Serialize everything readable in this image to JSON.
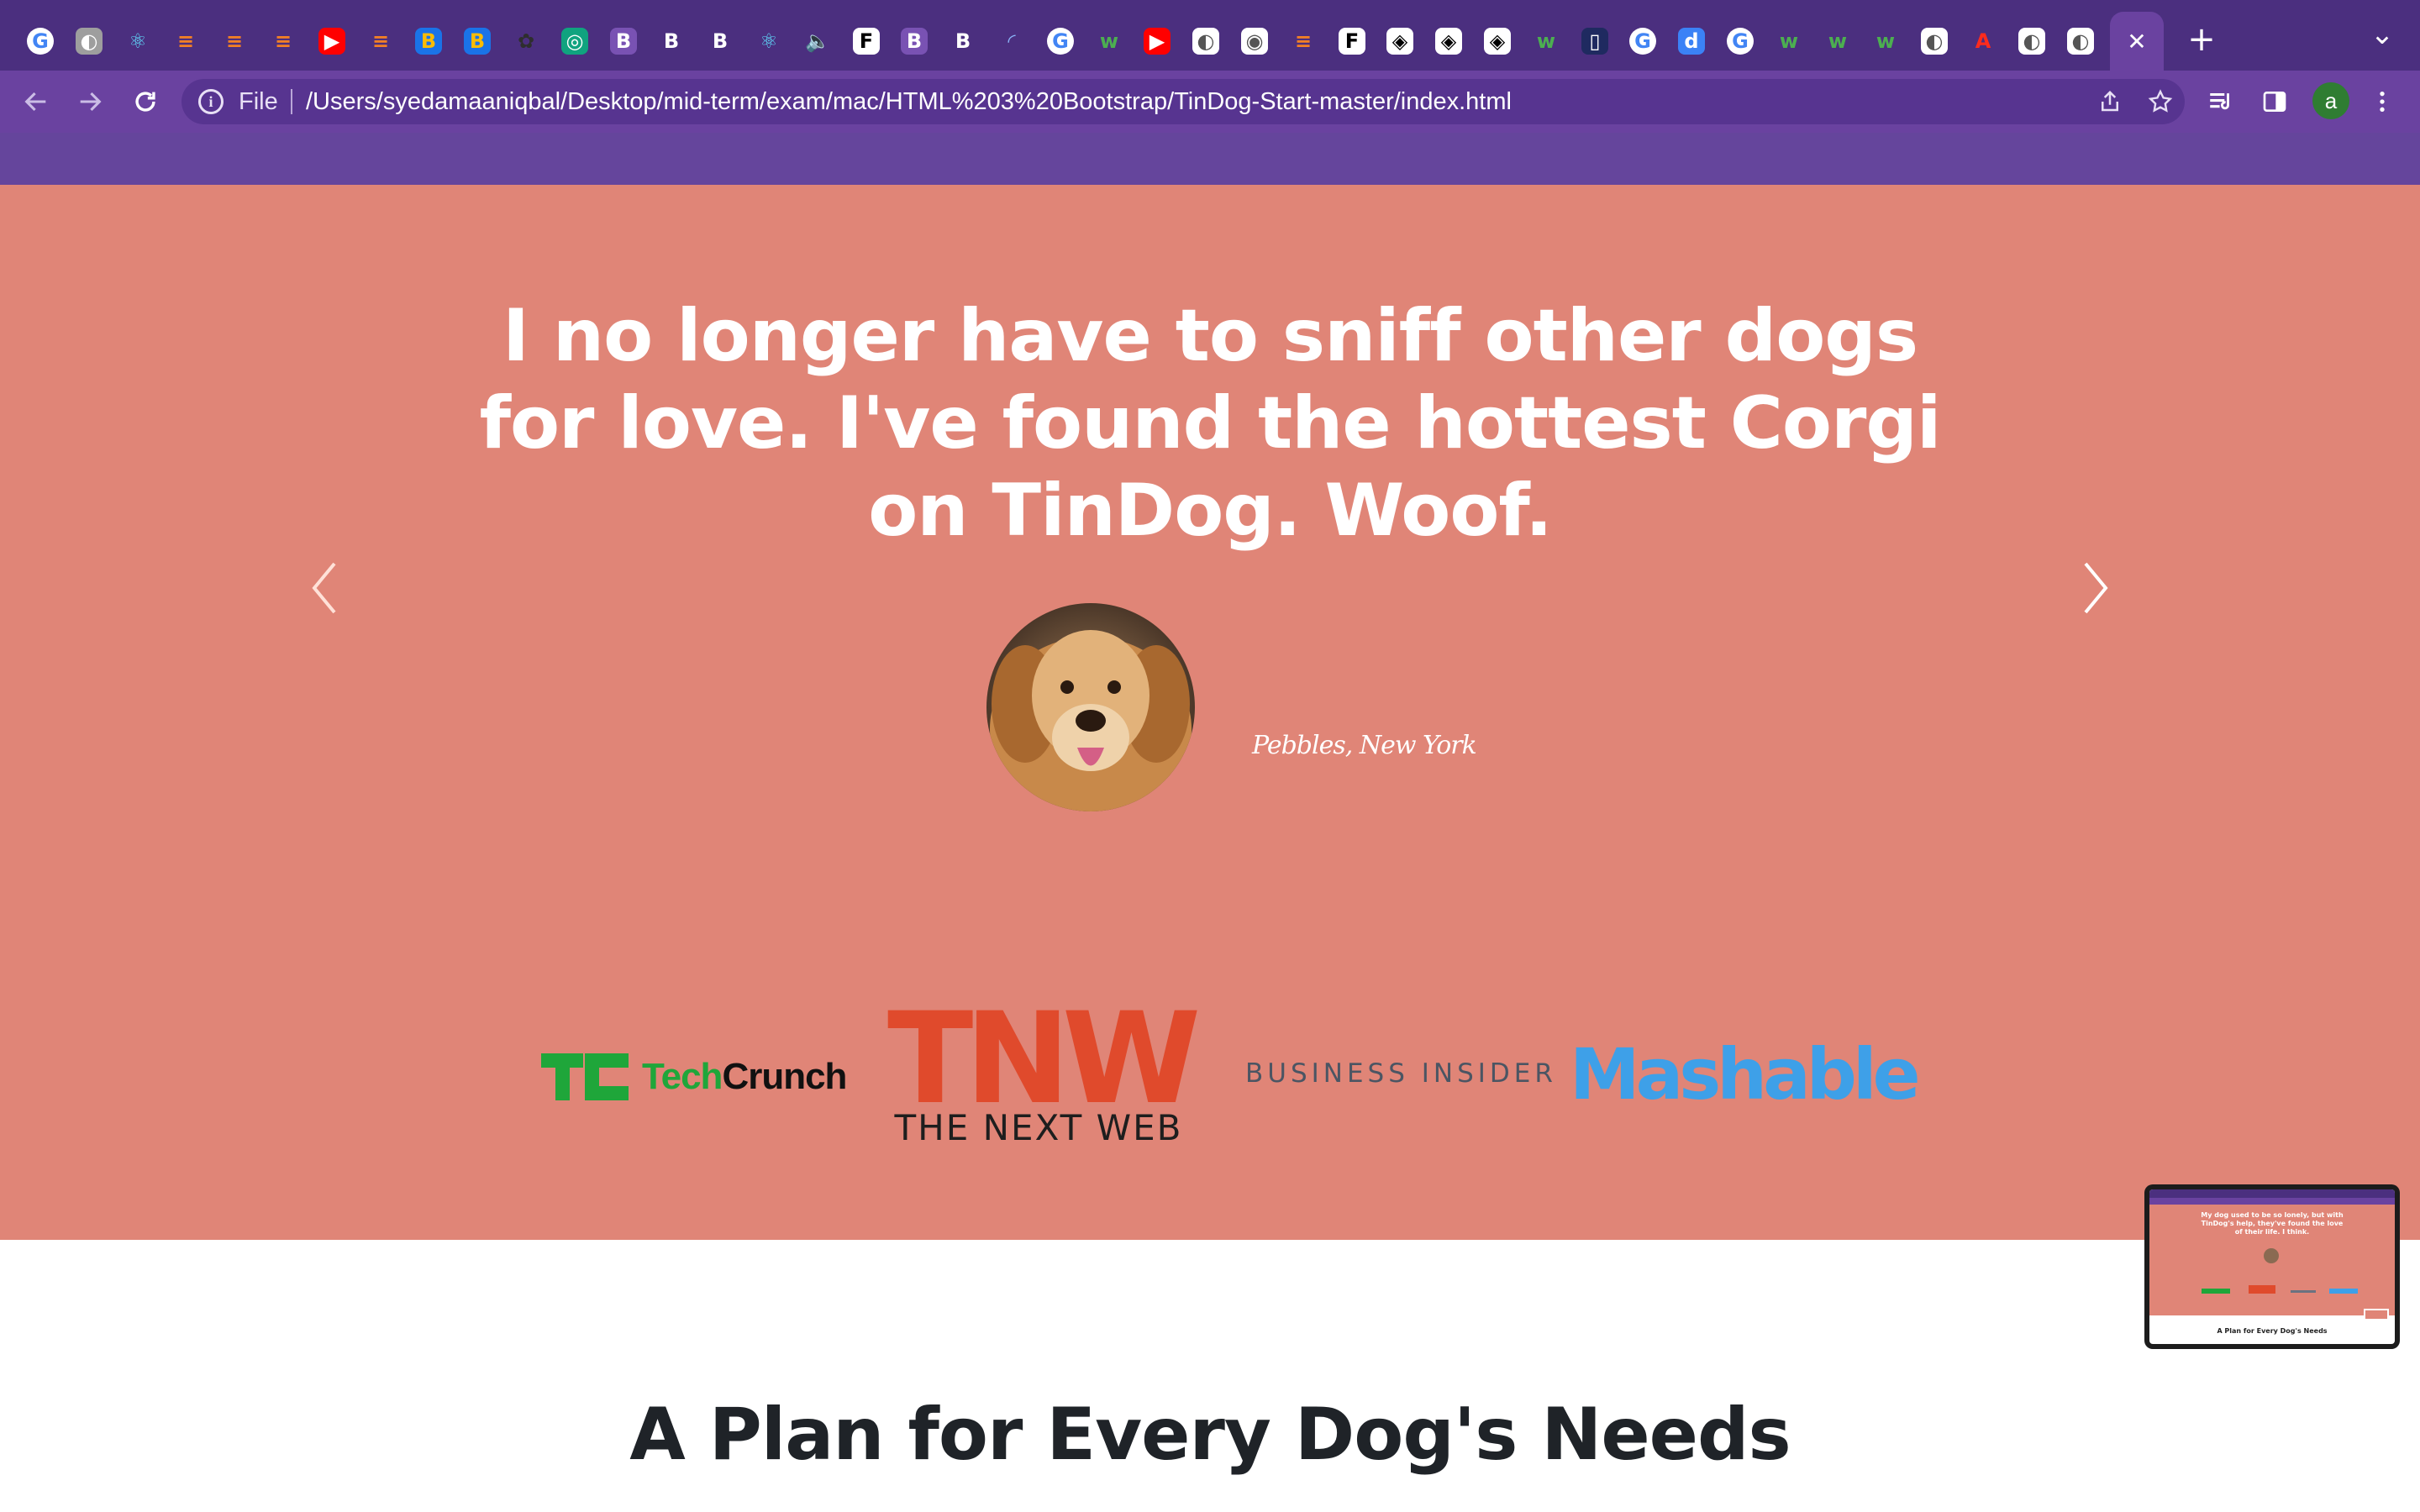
{
  "browser": {
    "tabs": [
      {
        "icon": "google-icon",
        "glyph": "G",
        "color": "#ffffff",
        "text_color": "#4285f4"
      },
      {
        "icon": "globe-icon",
        "glyph": "◐",
        "color": "#9e9e9e",
        "text_color": "#ffffff"
      },
      {
        "icon": "react-icon",
        "glyph": "⚛",
        "color": "transparent",
        "text_color": "#61dafb"
      },
      {
        "icon": "stackoverflow-icon",
        "glyph": "≡",
        "color": "transparent",
        "text_color": "#f48024"
      },
      {
        "icon": "stackoverflow-icon",
        "glyph": "≡",
        "color": "transparent",
        "text_color": "#f48024"
      },
      {
        "icon": "stackoverflow-icon",
        "glyph": "≡",
        "color": "transparent",
        "text_color": "#f48024"
      },
      {
        "icon": "youtube-icon",
        "glyph": "▶",
        "color": "#ff0000",
        "text_color": "#ffffff"
      },
      {
        "icon": "stackoverflow-icon",
        "glyph": "≡",
        "color": "transparent",
        "text_color": "#f48024"
      },
      {
        "icon": "colorful-b-icon",
        "glyph": "B",
        "color": "#1a73e8",
        "text_color": "#fbbc04"
      },
      {
        "icon": "colorful-b-icon",
        "glyph": "B",
        "color": "#1a73e8",
        "text_color": "#fbbc04"
      },
      {
        "icon": "dark-leaf-icon",
        "glyph": "✿",
        "color": "transparent",
        "text_color": "#2e2e2e"
      },
      {
        "icon": "chatgpt-icon",
        "glyph": "◎",
        "color": "#10a37f",
        "text_color": "#ffffff"
      },
      {
        "icon": "bootstrap-icon",
        "glyph": "B",
        "color": "#7952b3",
        "text_color": "#ffffff"
      },
      {
        "icon": "bold-b-icon",
        "glyph": "B",
        "color": "transparent",
        "text_color": "#ffffff"
      },
      {
        "icon": "bold-b-icon",
        "glyph": "B",
        "color": "transparent",
        "text_color": "#ffffff"
      },
      {
        "icon": "react-icon",
        "glyph": "⚛",
        "color": "transparent",
        "text_color": "#61dafb"
      },
      {
        "icon": "audio-playing-icon",
        "glyph": "🔈",
        "color": "transparent",
        "text_color": "#ffffff"
      },
      {
        "icon": "font-f-icon",
        "glyph": "F",
        "color": "#ffffff",
        "text_color": "#000000"
      },
      {
        "icon": "bootstrap-icon",
        "glyph": "B",
        "color": "#7952b3",
        "text_color": "#ffffff"
      },
      {
        "icon": "bold-b-icon",
        "glyph": "B",
        "color": "transparent",
        "text_color": "#ffffff"
      },
      {
        "icon": "loading-spinner-icon",
        "glyph": "◜",
        "color": "transparent",
        "text_color": "#8ab4f8"
      },
      {
        "icon": "google-icon",
        "glyph": "G",
        "color": "#ffffff",
        "text_color": "#4285f4"
      },
      {
        "icon": "w3-icon",
        "glyph": "w",
        "color": "transparent",
        "text_color": "#4caf50"
      },
      {
        "icon": "youtube-icon",
        "glyph": "▶",
        "color": "#ff0000",
        "text_color": "#ffffff"
      },
      {
        "icon": "globe-icon",
        "glyph": "◐",
        "color": "#ffffff",
        "text_color": "#555555"
      },
      {
        "icon": "chrome-icon",
        "glyph": "◉",
        "color": "#ffffff",
        "text_color": "#555555"
      },
      {
        "icon": "stackoverflow-icon",
        "glyph": "≡",
        "color": "transparent",
        "text_color": "#f48024"
      },
      {
        "icon": "font-f-icon",
        "glyph": "F",
        "color": "#ffffff",
        "text_color": "#000000"
      },
      {
        "icon": "codepen-icon",
        "glyph": "◈",
        "color": "#ffffff",
        "text_color": "#000000"
      },
      {
        "icon": "codepen-icon",
        "glyph": "◈",
        "color": "#ffffff",
        "text_color": "#000000"
      },
      {
        "icon": "codepen-icon",
        "glyph": "◈",
        "color": "#ffffff",
        "text_color": "#000000"
      },
      {
        "icon": "w3-icon",
        "glyph": "w",
        "color": "transparent",
        "text_color": "#4caf50"
      },
      {
        "icon": "document-icon",
        "glyph": "▯",
        "color": "#1f2a60",
        "text_color": "#ffffff"
      },
      {
        "icon": "google-icon",
        "glyph": "G",
        "color": "#ffffff",
        "text_color": "#4285f4"
      },
      {
        "icon": "d-icon",
        "glyph": "d",
        "color": "#3b82f6",
        "text_color": "#ffffff"
      },
      {
        "icon": "google-icon",
        "glyph": "G",
        "color": "#ffffff",
        "text_color": "#4285f4"
      },
      {
        "icon": "w3-icon",
        "glyph": "w",
        "color": "transparent",
        "text_color": "#4caf50"
      },
      {
        "icon": "w3-icon",
        "glyph": "w",
        "color": "transparent",
        "text_color": "#4caf50"
      },
      {
        "icon": "w3-icon",
        "glyph": "w",
        "color": "transparent",
        "text_color": "#4caf50"
      },
      {
        "icon": "globe-icon",
        "glyph": "◐",
        "color": "#ffffff",
        "text_color": "#555555"
      },
      {
        "icon": "acrobat-icon",
        "glyph": "A",
        "color": "transparent",
        "text_color": "#ff2b1c"
      },
      {
        "icon": "globe-icon",
        "glyph": "◐",
        "color": "#ffffff",
        "text_color": "#555555"
      },
      {
        "icon": "globe-icon",
        "glyph": "◐",
        "color": "#ffffff",
        "text_color": "#555555"
      }
    ],
    "active_tab": {
      "icon": "close-icon",
      "glyph": "✕"
    },
    "new_tab_glyph": "+",
    "tab_menu_glyph": "⌄",
    "omnibox": {
      "scheme": "File",
      "url": "/Users/syedamaaniqbal/Desktop/mid-term/exam/mac/HTML%203%20Bootstrap/TinDog-Start-master/index.html"
    },
    "profile_initial": "a",
    "colors": {
      "tabstrip": "#4b2f7f",
      "toolbar": "#6a42a0",
      "omnibox": "#573490"
    }
  },
  "page": {
    "testimonial": {
      "quote": "I no longer have to sniff other dogs for love. I've found the hottest Corgi on TinDog. Woof.",
      "attribution": "Pebbles, New York"
    },
    "press": {
      "techcrunch_tech": "Tech",
      "techcrunch_crunch": "Crunch",
      "tnw_big": "TNW",
      "tnw_small": "THE NEXT WEB",
      "business_insider": "BUSINESS INSIDER",
      "mashable": "Mashable"
    },
    "pricing_title": "A Plan for Every Dog's Needs",
    "colors": {
      "testimonial_bg": "#e08577",
      "nav_bg": "#65459c",
      "heading": "#1f2328"
    }
  },
  "preview_thumbnail": {
    "quote": "My dog used to be so lonely, but with TinDog's help, they've found the love of their life. I think.",
    "title": "A Plan for Every Dog's Needs"
  }
}
